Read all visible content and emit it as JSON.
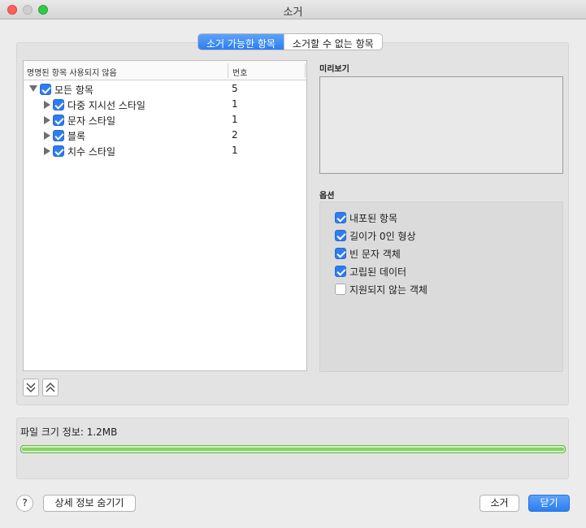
{
  "window": {
    "title": "소거"
  },
  "tabs": {
    "active": "소거 가능한 항목",
    "inactive": "소거할 수 없는 항목"
  },
  "tree": {
    "header_name": "명명된 항목 사용되지 않음",
    "header_num": "번호",
    "rows": [
      {
        "label": "모든 항목",
        "num": "5",
        "checked": true,
        "expanded": true
      },
      {
        "label": "다중 지시선 스타일",
        "num": "1",
        "checked": true,
        "expanded": false
      },
      {
        "label": "문자 스타일",
        "num": "1",
        "checked": true,
        "expanded": false
      },
      {
        "label": "블록",
        "num": "2",
        "checked": true,
        "expanded": false
      },
      {
        "label": "치수 스타일",
        "num": "1",
        "checked": true,
        "expanded": false
      }
    ]
  },
  "preview": {
    "label": "미리보기"
  },
  "options": {
    "label": "옵션",
    "items": [
      {
        "label": "내포된 항목",
        "checked": true
      },
      {
        "label": "길이가 0인 형상",
        "checked": true
      },
      {
        "label": "빈 문자 객체",
        "checked": true
      },
      {
        "label": "고립된 데이터",
        "checked": true
      },
      {
        "label": "지원되지 않는 객체",
        "checked": false
      }
    ]
  },
  "file_info": {
    "text": "파일 크기 정보: 1.2MB",
    "progress": 1.0
  },
  "footer": {
    "help": "?",
    "details": "상세 정보 숨기기",
    "purge": "소거",
    "close": "닫기"
  },
  "colors": {
    "accent": "#2f7cf0",
    "progress_green": "#84d263"
  }
}
